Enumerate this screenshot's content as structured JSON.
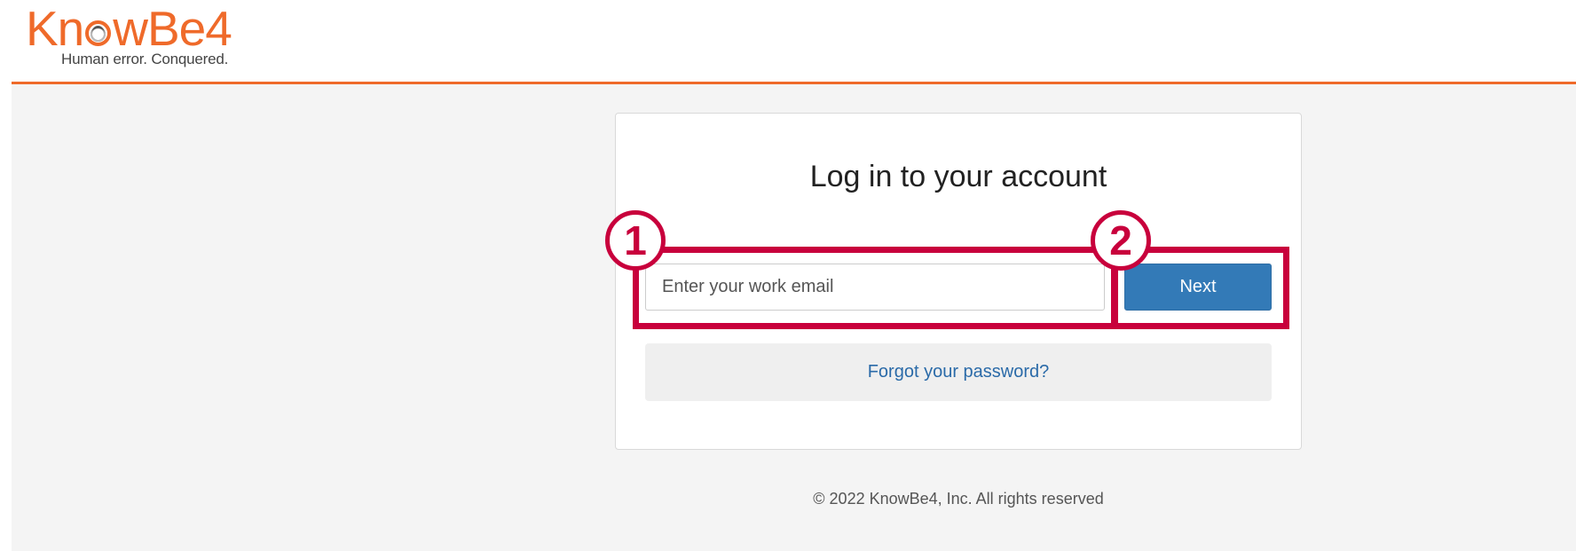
{
  "brand": {
    "name_part1": "Kn",
    "name_part2": "wBe4",
    "tagline": "Human error. Conquered.",
    "accent_color": "#ef6a2a"
  },
  "login": {
    "title": "Log in to your account",
    "email_placeholder": "Enter your work email",
    "email_value": "",
    "next_label": "Next",
    "forgot_label": "Forgot your password?"
  },
  "footer": {
    "copyright": "© 2022 KnowBe4, Inc. All rights reserved"
  },
  "annotations": {
    "color": "#c8003c",
    "markers": [
      {
        "label": "1",
        "target": "email input"
      },
      {
        "label": "2",
        "target": "next button"
      }
    ]
  }
}
